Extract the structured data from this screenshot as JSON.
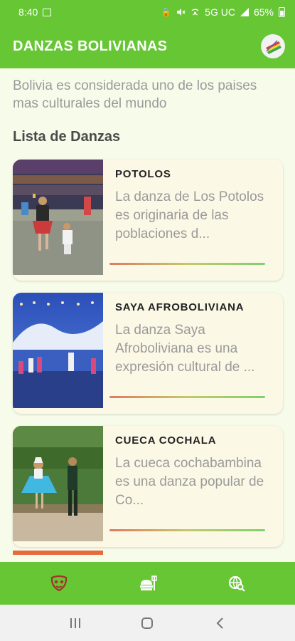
{
  "status_bar": {
    "time": "8:40",
    "network": "5G UC",
    "battery": "65%"
  },
  "app_bar": {
    "title": "DANZAS BOLIVIANAS"
  },
  "intro_text": "Bolivia es considerada uno de los paises mas culturales del mundo",
  "section_title": "Lista de Danzas",
  "dances": [
    {
      "title": "POTOLOS",
      "description": "La danza de Los Potolos es originaria de las poblaciones d..."
    },
    {
      "title": "SAYA AFROBOLIVIANA",
      "description": "La danza Saya Afroboliviana es una expresión cultural de ..."
    },
    {
      "title": "CUECA COCHALA",
      "description": "La cueca cochabambina es una danza popular de Co..."
    }
  ],
  "icons": {
    "status": [
      "image-icon",
      "lock-icon",
      "mute-icon",
      "hotspot-icon",
      "signal-icon",
      "battery-icon"
    ],
    "app_bar": "bolivia-flag-icon",
    "bottom_nav": [
      "dance-mask-icon",
      "food-icon",
      "globe-search-icon"
    ],
    "system_nav": [
      "recents-icon",
      "home-icon",
      "back-icon"
    ]
  },
  "colors": {
    "primary": "#66c634",
    "card_bg": "#fcf8e6",
    "page_bg": "#f7fbe9",
    "muted_text": "#9a9a9a",
    "nav_icon": "#a5322a"
  }
}
